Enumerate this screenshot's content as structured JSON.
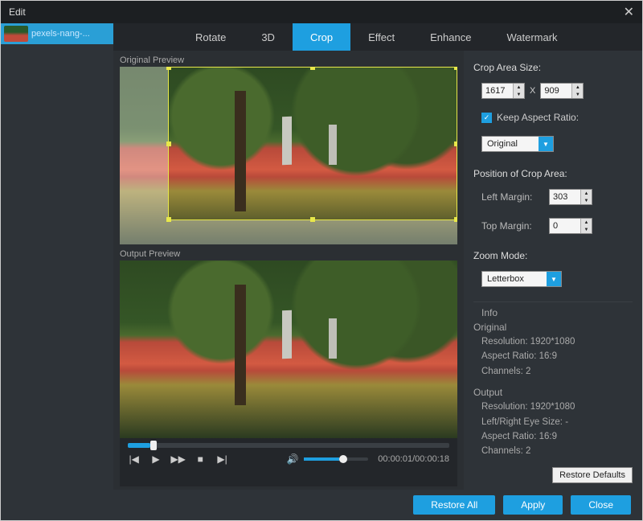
{
  "window": {
    "title": "Edit"
  },
  "sidebar": {
    "items": [
      {
        "label": "pexels-nang-..."
      }
    ]
  },
  "tabs": [
    {
      "label": "Rotate",
      "active": false
    },
    {
      "label": "3D",
      "active": false
    },
    {
      "label": "Crop",
      "active": true
    },
    {
      "label": "Effect",
      "active": false
    },
    {
      "label": "Enhance",
      "active": false
    },
    {
      "label": "Watermark",
      "active": false
    }
  ],
  "preview": {
    "original_label": "Original Preview",
    "output_label": "Output Preview",
    "time_current": "00:00:01",
    "time_total": "00:00:18"
  },
  "crop": {
    "heading": "Crop Area Size:",
    "width": "1617",
    "height": "909",
    "x_label": "X",
    "keep_ratio_label": "Keep Aspect Ratio:",
    "keep_ratio_checked": true,
    "ratio_mode": "Original"
  },
  "position": {
    "heading": "Position of Crop Area:",
    "left_label": "Left Margin:",
    "left_value": "303",
    "top_label": "Top Margin:",
    "top_value": "0"
  },
  "zoom": {
    "heading": "Zoom Mode:",
    "value": "Letterbox"
  },
  "info": {
    "heading": "Info",
    "original": {
      "title": "Original",
      "resolution": "Resolution: 1920*1080",
      "aspect": "Aspect Ratio: 16:9",
      "channels": "Channels: 2"
    },
    "output": {
      "title": "Output",
      "resolution": "Resolution: 1920*1080",
      "eyesize": "Left/Right Eye Size: -",
      "aspect": "Aspect Ratio: 16:9",
      "channels": "Channels: 2"
    }
  },
  "buttons": {
    "restore_defaults": "Restore Defaults",
    "restore_all": "Restore All",
    "apply": "Apply",
    "close": "Close"
  }
}
